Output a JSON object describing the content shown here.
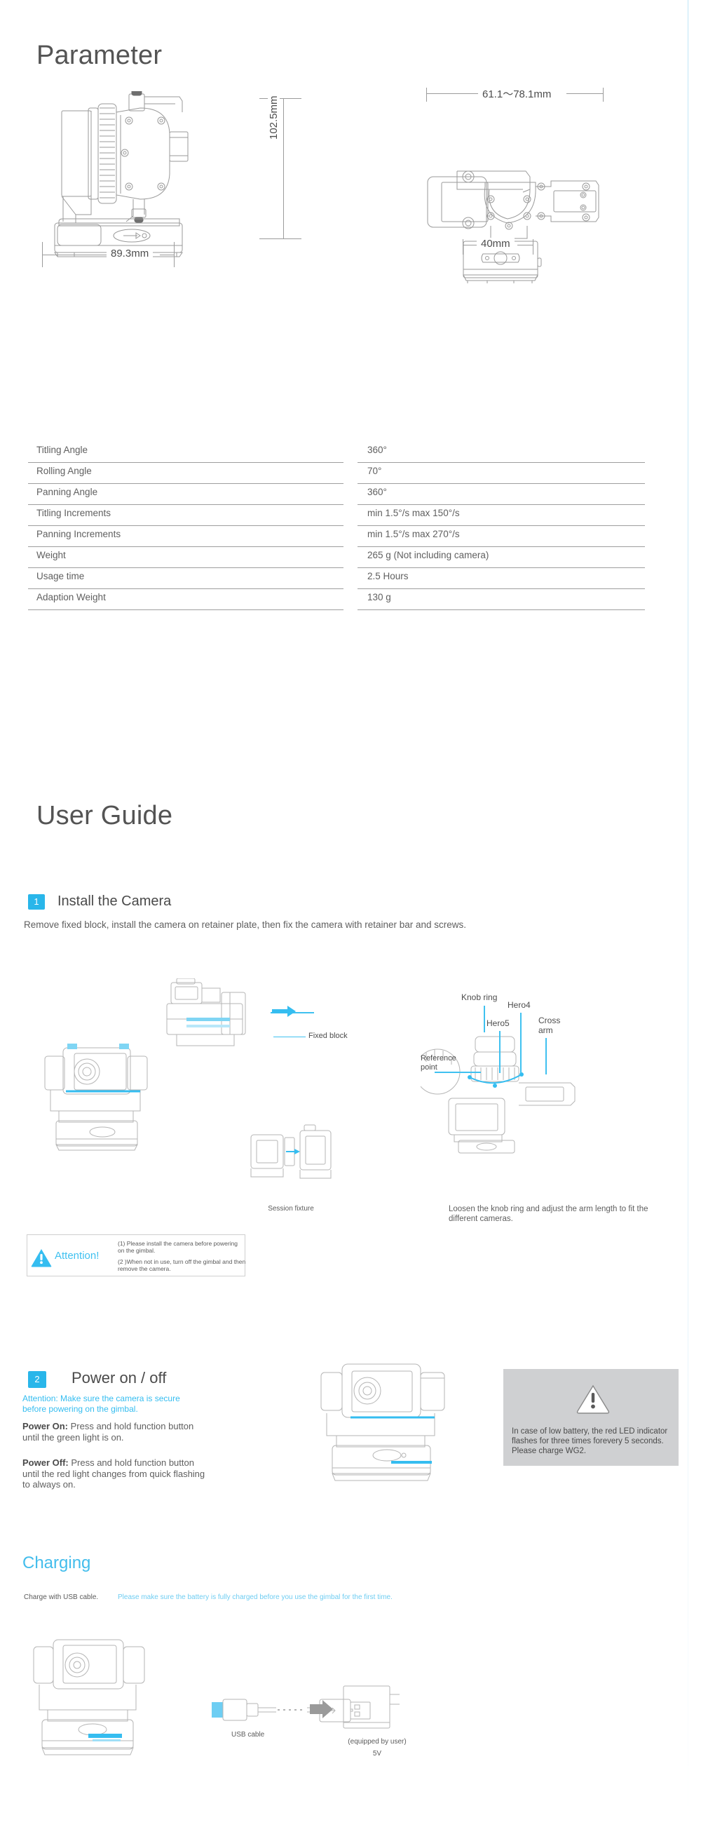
{
  "sections": {
    "parameter_title": "Parameter",
    "user_guide_title": "User Guide",
    "charging_title": "Charging"
  },
  "drawings": {
    "side_view": {
      "height_label": "102.5mm",
      "width_label": "89.3mm"
    },
    "front_view": {
      "width_label": "61.1～78.1mm",
      "base_label": "40mm"
    }
  },
  "spec_table": {
    "rows": [
      {
        "name": "Titling Angle",
        "value": "360°"
      },
      {
        "name": "Rolling Angle",
        "value": "70°"
      },
      {
        "name": "Panning Angle",
        "value": "360°"
      },
      {
        "name": "Titling Increments",
        "value": "min 1.5°/s max 150°/s"
      },
      {
        "name": "Panning Increments",
        "value": "min 1.5°/s max 270°/s"
      },
      {
        "name": "Weight",
        "value": "265 g  (Not including camera)"
      },
      {
        "name": "Usage time",
        "value": "2.5 Hours"
      },
      {
        "name": "Adaption Weight",
        "value": "130 g"
      }
    ]
  },
  "step1": {
    "number": "1",
    "title": "Install the Camera",
    "description": "Remove fixed  block, install the camera on retainer plate, then fix the  camera with retainer bar and screws.",
    "labels": {
      "fixed_block": "Fixed  block",
      "session_fixture": "Session fixture",
      "knob_ring": "Knob ring",
      "hero5": "Hero5",
      "hero4": "Hero4",
      "cross_arm_1": "Cross",
      "cross_arm_2": "arm",
      "reference_1": "Reference",
      "reference_2": "point"
    },
    "knob_note": "Loosen the knob ring and adjust the arm length to fit the different cameras.",
    "attention": {
      "word": "Attention!",
      "line1": "(1) Please install the camera before powering",
      "line2": "on the gimbal.",
      "line3": "(2 )When not in use, turn off the gimbal and then",
      "line4": "remove the camera."
    }
  },
  "step2": {
    "number": "2",
    "title": "Power on / off",
    "attention_line1": "Attention: Make sure the camera is secure",
    "attention_line2": "before powering on the gimbal.",
    "power_on_bold": "Power On:",
    "power_on_rest": " Press and hold function button until the green light is on.",
    "power_off_bold": "Power Off:",
    "power_off_rest": " Press and hold function button until the red light changes from quick flashing to always on.",
    "low_battery_note": "In case of low battery, the red LED indicator flashes for three times forevery 5 seconds. Please charge WG2."
  },
  "charging": {
    "lead": "Charge with USB cable.",
    "note": "Please make sure the battery is fully charged before you use the gimbal for the first time.",
    "usb_cable_label": "USB cable",
    "adapter_label": "(equipped by user)",
    "adapter_voltage": "5V"
  },
  "colors": {
    "accent": "#35bdf0",
    "text": "#5b5b5b",
    "rule": "#9e9e9e",
    "gray_box": "#cfd0d2"
  }
}
